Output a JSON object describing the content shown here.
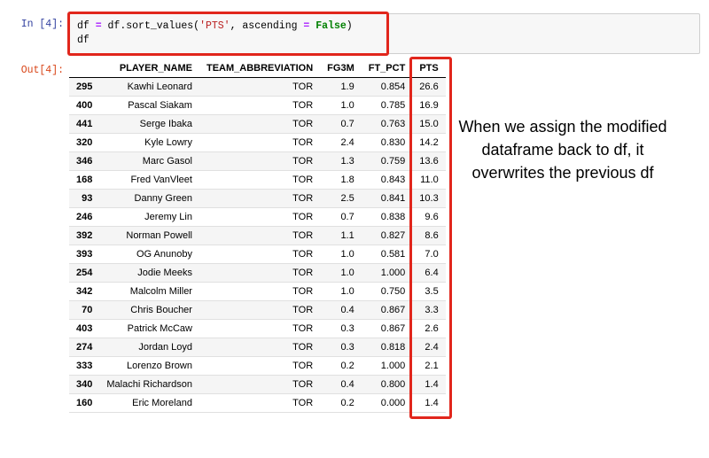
{
  "notebook": {
    "in_prompt": "In [4]:",
    "out_prompt": "Out[4]:",
    "code_parts": {
      "a": "df ",
      "b": "=",
      "c": " df",
      "d": ".",
      "e": "sort_values(",
      "f": "'PTS'",
      "g": ", ascending ",
      "h": "=",
      "i": " ",
      "j": "False",
      "k": ")",
      "l": "df"
    }
  },
  "table": {
    "columns": [
      "PLAYER_NAME",
      "TEAM_ABBREVIATION",
      "FG3M",
      "FT_PCT",
      "PTS"
    ],
    "rows": [
      {
        "idx": "295",
        "cells": [
          "Kawhi Leonard",
          "TOR",
          "1.9",
          "0.854",
          "26.6"
        ]
      },
      {
        "idx": "400",
        "cells": [
          "Pascal Siakam",
          "TOR",
          "1.0",
          "0.785",
          "16.9"
        ]
      },
      {
        "idx": "441",
        "cells": [
          "Serge Ibaka",
          "TOR",
          "0.7",
          "0.763",
          "15.0"
        ]
      },
      {
        "idx": "320",
        "cells": [
          "Kyle Lowry",
          "TOR",
          "2.4",
          "0.830",
          "14.2"
        ]
      },
      {
        "idx": "346",
        "cells": [
          "Marc Gasol",
          "TOR",
          "1.3",
          "0.759",
          "13.6"
        ]
      },
      {
        "idx": "168",
        "cells": [
          "Fred VanVleet",
          "TOR",
          "1.8",
          "0.843",
          "11.0"
        ]
      },
      {
        "idx": "93",
        "cells": [
          "Danny Green",
          "TOR",
          "2.5",
          "0.841",
          "10.3"
        ]
      },
      {
        "idx": "246",
        "cells": [
          "Jeremy Lin",
          "TOR",
          "0.7",
          "0.838",
          "9.6"
        ]
      },
      {
        "idx": "392",
        "cells": [
          "Norman Powell",
          "TOR",
          "1.1",
          "0.827",
          "8.6"
        ]
      },
      {
        "idx": "393",
        "cells": [
          "OG Anunoby",
          "TOR",
          "1.0",
          "0.581",
          "7.0"
        ]
      },
      {
        "idx": "254",
        "cells": [
          "Jodie Meeks",
          "TOR",
          "1.0",
          "1.000",
          "6.4"
        ]
      },
      {
        "idx": "342",
        "cells": [
          "Malcolm Miller",
          "TOR",
          "1.0",
          "0.750",
          "3.5"
        ]
      },
      {
        "idx": "70",
        "cells": [
          "Chris Boucher",
          "TOR",
          "0.4",
          "0.867",
          "3.3"
        ]
      },
      {
        "idx": "403",
        "cells": [
          "Patrick McCaw",
          "TOR",
          "0.3",
          "0.867",
          "2.6"
        ]
      },
      {
        "idx": "274",
        "cells": [
          "Jordan Loyd",
          "TOR",
          "0.3",
          "0.818",
          "2.4"
        ]
      },
      {
        "idx": "333",
        "cells": [
          "Lorenzo Brown",
          "TOR",
          "0.2",
          "1.000",
          "2.1"
        ]
      },
      {
        "idx": "340",
        "cells": [
          "Malachi Richardson",
          "TOR",
          "0.4",
          "0.800",
          "1.4"
        ]
      },
      {
        "idx": "160",
        "cells": [
          "Eric Moreland",
          "TOR",
          "0.2",
          "0.000",
          "1.4"
        ]
      }
    ]
  },
  "annotation": "When we assign the modified dataframe back to df, it overwrites the previous df"
}
